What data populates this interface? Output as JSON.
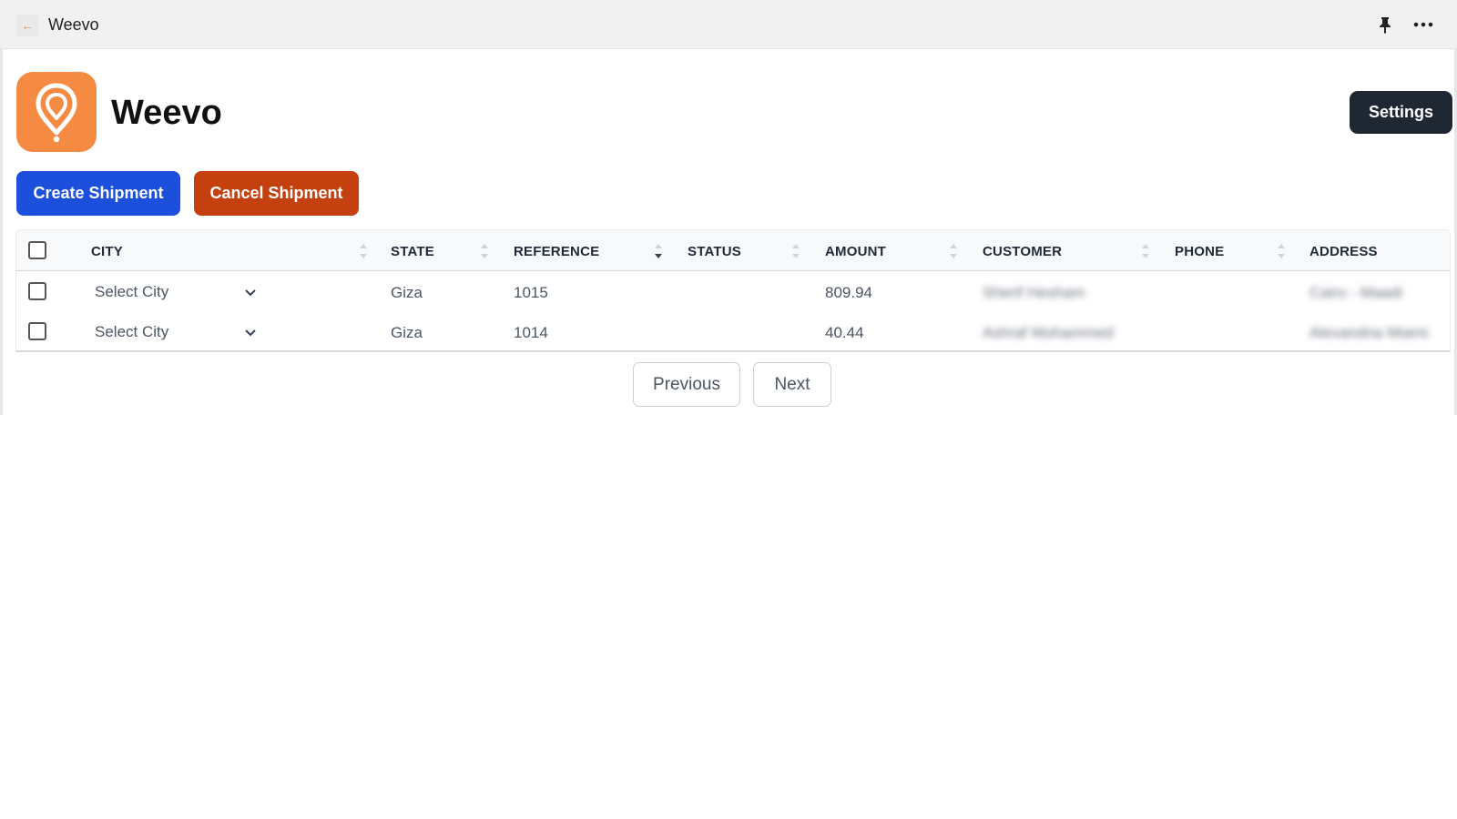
{
  "window": {
    "title": "Weevo",
    "back_icon": "arrow-left-icon",
    "pin_icon": "pin-icon",
    "more_icon": "more-horizontal-icon"
  },
  "header": {
    "app_name": "Weevo",
    "logo_icon": "map-pin-icon",
    "settings_label": "Settings"
  },
  "actions": {
    "create_label": "Create Shipment",
    "cancel_label": "Cancel Shipment"
  },
  "colors": {
    "brand_orange": "#f58a43",
    "primary_blue": "#1c4fdc",
    "danger_orange": "#c4410f",
    "dark_button": "#1f2733"
  },
  "table": {
    "columns": [
      "CITY",
      "STATE",
      "REFERENCE",
      "STATUS",
      "AMOUNT",
      "CUSTOMER",
      "PHONE",
      "ADDRESS"
    ],
    "rows": [
      {
        "city_placeholder": "Select City",
        "state": "Giza",
        "reference": "1015",
        "status": "",
        "amount": "809.94",
        "customer": "Sherif Hesham",
        "phone": "",
        "address": "Cairo - Maadi"
      },
      {
        "city_placeholder": "Select City",
        "state": "Giza",
        "reference": "1014",
        "status": "",
        "amount": "40.44",
        "customer": "Ashraf Mohammed",
        "phone": "",
        "address": "Alexandria Miami"
      }
    ]
  },
  "pagination": {
    "previous_label": "Previous",
    "next_label": "Next"
  }
}
